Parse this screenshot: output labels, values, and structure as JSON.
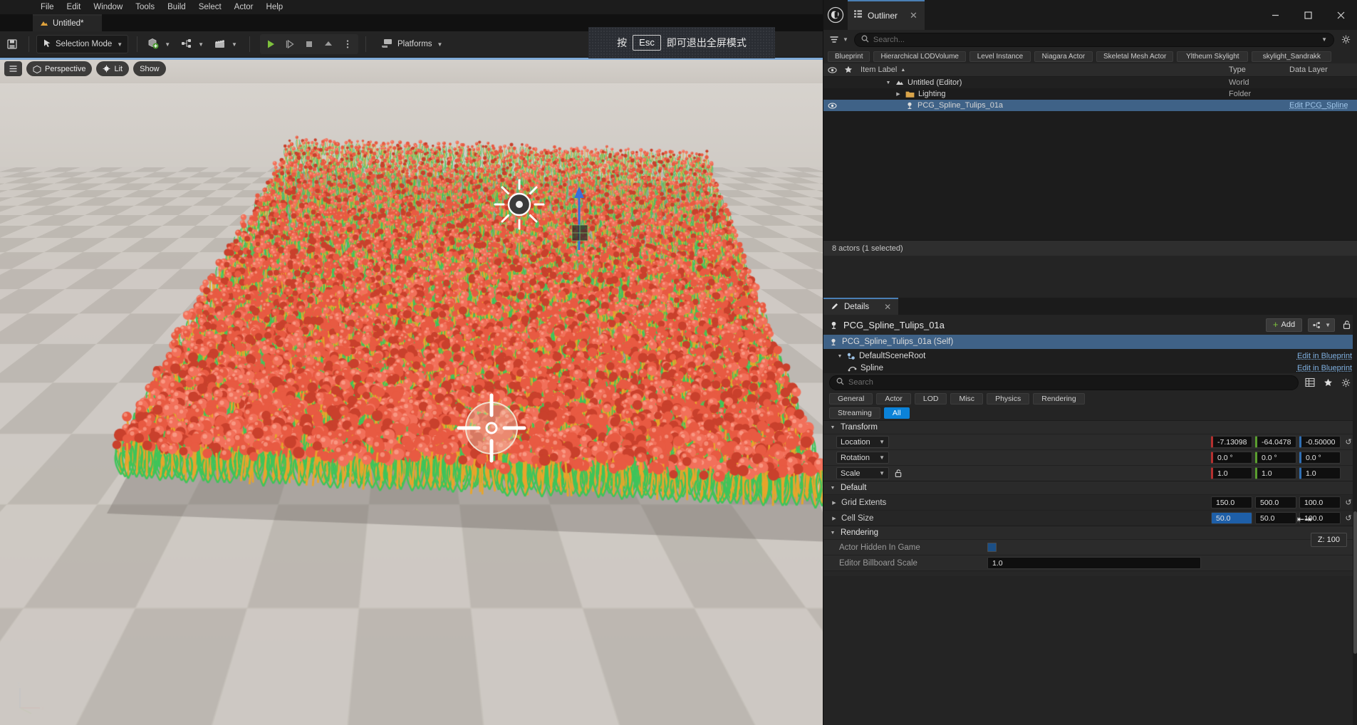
{
  "app": {
    "title": "Unreal Editor",
    "document_tab": "Untitled*"
  },
  "menubar": {
    "items": [
      "File",
      "Edit",
      "Window",
      "Tools",
      "Build",
      "Select",
      "Actor",
      "Help"
    ]
  },
  "toolbar": {
    "selection_mode": "Selection Mode",
    "platforms": "Platforms"
  },
  "banner": {
    "prefix": "按",
    "key": "Esc",
    "suffix": "即可退出全屏模式"
  },
  "viewport": {
    "perspective": "Perspective",
    "lit": "Lit",
    "show": "Show"
  },
  "outliner": {
    "tab_title": "Outliner",
    "search_placeholder": "Search...",
    "filter_chips": [
      "Blueprint",
      "Hierarchical LODVolume",
      "Level Instance",
      "Niagara Actor",
      "Skeletal Mesh Actor",
      "Yltheum Skylight",
      "skylight_Sandrakk"
    ],
    "columns": {
      "item_label": "Item Label",
      "type": "Type",
      "data_layer": "Data Layer"
    },
    "rows": [
      {
        "label": "Untitled (Editor)",
        "type": "World",
        "data_layer": "",
        "indent": 1,
        "expanded": true,
        "selected": false,
        "icon": "world-icon"
      },
      {
        "label": "Lighting",
        "type": "Folder",
        "data_layer": "",
        "indent": 2,
        "expanded": false,
        "selected": false,
        "icon": "folder-icon"
      },
      {
        "label": "PCG_Spline_Tulips_01a",
        "type": "",
        "data_layer": "Edit PCG_Spline",
        "indent": 2,
        "expanded": false,
        "selected": true,
        "icon": "actor-icon"
      }
    ],
    "status": "8 actors (1 selected)"
  },
  "details": {
    "tab_title": "Details",
    "actor_name": "PCG_Spline_Tulips_01a",
    "add_label": "Add",
    "components": [
      {
        "label": "PCG_Spline_Tulips_01a (Self)",
        "edit_link": "",
        "indent": 0,
        "selected": true
      },
      {
        "label": "DefaultSceneRoot",
        "edit_link": "Edit in Blueprint",
        "indent": 1,
        "selected": false
      },
      {
        "label": "Spline",
        "edit_link": "Edit in Blueprint",
        "indent": 2,
        "selected": false
      }
    ],
    "search_placeholder": "Search",
    "category_tabs": [
      "General",
      "Actor",
      "LOD",
      "Misc",
      "Physics",
      "Rendering"
    ],
    "category_tabs_row2": [
      "Streaming",
      "All"
    ],
    "active_category": "All",
    "sections": {
      "transform": {
        "title": "Transform",
        "rows": [
          {
            "name": "Location",
            "mode": "Location",
            "x": "-7.13098",
            "y": "-64.0478",
            "z": "-0.50000",
            "unit": ""
          },
          {
            "name": "Rotation",
            "mode": "Rotation",
            "x": "0.0 °",
            "y": "0.0 °",
            "z": "0.0 °",
            "unit": ""
          },
          {
            "name": "Scale",
            "mode": "Scale",
            "x": "1.0",
            "y": "1.0",
            "z": "1.0",
            "unit": ""
          }
        ]
      },
      "default": {
        "title": "Default",
        "rows": [
          {
            "name": "Grid Extents",
            "x": "150.0",
            "y": "500.0",
            "z": "100.0",
            "selected_field": ""
          },
          {
            "name": "Cell Size",
            "x": "50.0",
            "y": "50.0",
            "z": "100.0",
            "selected_field": "x"
          }
        ]
      },
      "rendering": {
        "title": "Rendering",
        "actor_hidden_in_game": {
          "label": "Actor Hidden In Game",
          "checked": true
        },
        "editor_billboard_scale": {
          "label": "Editor Billboard Scale",
          "value": "1.0"
        }
      }
    }
  },
  "tooltip": {
    "z_value": "Z: 100"
  },
  "colors": {
    "accent_blue": "#0b82d8",
    "selection_blue": "#3f6287",
    "axis_x": "#b5302f",
    "axis_y": "#5a9e2f",
    "axis_z": "#2f6fb5",
    "tulip_red": "#e85a42",
    "leaf_green": "#3fc45a",
    "stem_yellow": "#e8a52a"
  }
}
